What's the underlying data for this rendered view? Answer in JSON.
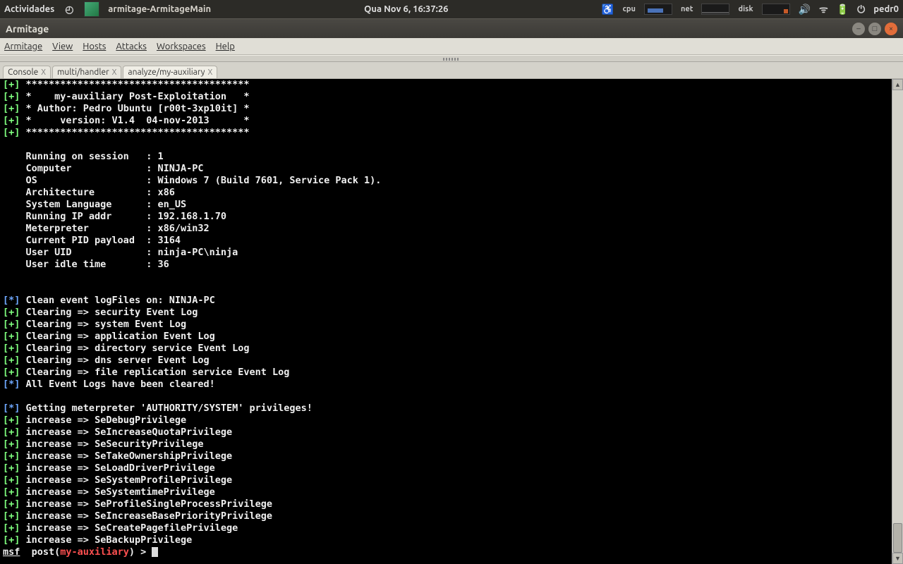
{
  "panel": {
    "activities": "Actividades",
    "task_title": "armitage-ArmitageMain",
    "clock": "Qua Nov  6, 16:37:26",
    "cpu_label": "cpu",
    "net_label": "net",
    "disk_label": "disk",
    "user": "pedr0"
  },
  "window": {
    "title": "Armitage"
  },
  "menu": {
    "armitage": "Armitage",
    "view": "View",
    "hosts": "Hosts",
    "attacks": "Attacks",
    "workspaces": "Workspaces",
    "help": "Help"
  },
  "tabs": [
    {
      "label": "Console",
      "active": false
    },
    {
      "label": "multi/handler",
      "active": false
    },
    {
      "label": "analyze/my-auxiliary",
      "active": true
    }
  ],
  "console": {
    "header": {
      "stars": "***************************************",
      "l1": "*    my-auxiliary Post-Exploitation   *",
      "l2": "* Author: Pedro Ubuntu [r00t-3xp10it] *",
      "l3": "*     version: V1.4  04-nov-2013      *"
    },
    "info": {
      "session": "Running on session   : 1",
      "computer": "Computer             : NINJA-PC",
      "os": "OS                   : Windows 7 (Build 7601, Service Pack 1).",
      "arch": "Architecture         : x86",
      "lang": "System Language      : en_US",
      "ip": "Running IP addr      : 192.168.1.70",
      "meterpreter": "Meterpreter          : x86/win32",
      "pid": "Current PID payload  : 3164",
      "uid": "User UID             : ninja-PC\\ninja",
      "idle": "User idle time       : 36"
    },
    "clean_title": "Clean event logFiles on: NINJA-PC",
    "clean_done": "All Event Logs have been cleared!",
    "clean": [
      "Clearing => security Event Log",
      "Clearing => system Event Log",
      "Clearing => application Event Log",
      "Clearing => directory service Event Log",
      "Clearing => dns server Event Log",
      "Clearing => file replication service Event Log"
    ],
    "priv_title": "Getting meterpreter 'AUTHORITY/SYSTEM' privileges!",
    "priv": [
      "increase => SeDebugPrivilege",
      "increase => SeIncreaseQuotaPrivilege",
      "increase => SeSecurityPrivilege",
      "increase => SeTakeOwnershipPrivilege",
      "increase => SeLoadDriverPrivilege",
      "increase => SeSystemProfilePrivilege",
      "increase => SeSystemtimePrivilege",
      "increase => SeProfileSingleProcessPrivilege",
      "increase => SeIncreaseBasePriorityPrivilege",
      "increase => SeCreatePagefilePrivilege",
      "increase => SeBackupPrivilege"
    ],
    "prompt": {
      "msf": "msf",
      "post": "  post(",
      "mod": "my-auxiliary",
      "tail": ") > "
    }
  }
}
